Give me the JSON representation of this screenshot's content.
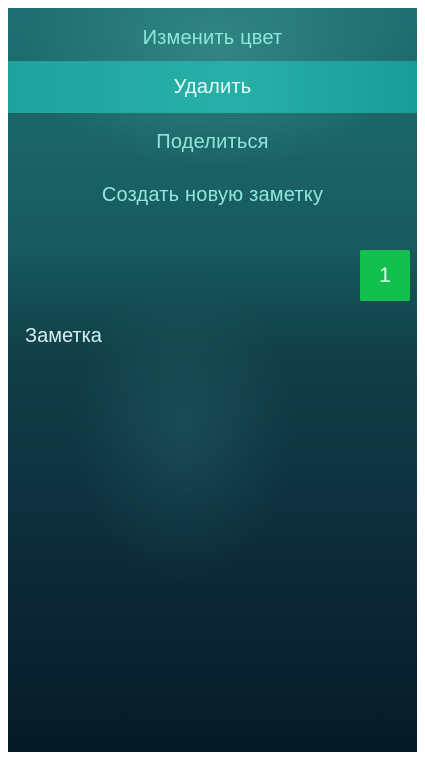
{
  "context_menu": {
    "items": [
      {
        "label": "Изменить цвет"
      },
      {
        "label": "Удалить"
      },
      {
        "label": "Поделиться"
      },
      {
        "label": "Создать новую заметку"
      }
    ],
    "highlighted_index": 1
  },
  "note": {
    "number": "1",
    "title": "Заметка",
    "color": "#13c04e"
  },
  "colors": {
    "menu_text": "#8fe6dc",
    "highlight": "#27b0a8"
  }
}
